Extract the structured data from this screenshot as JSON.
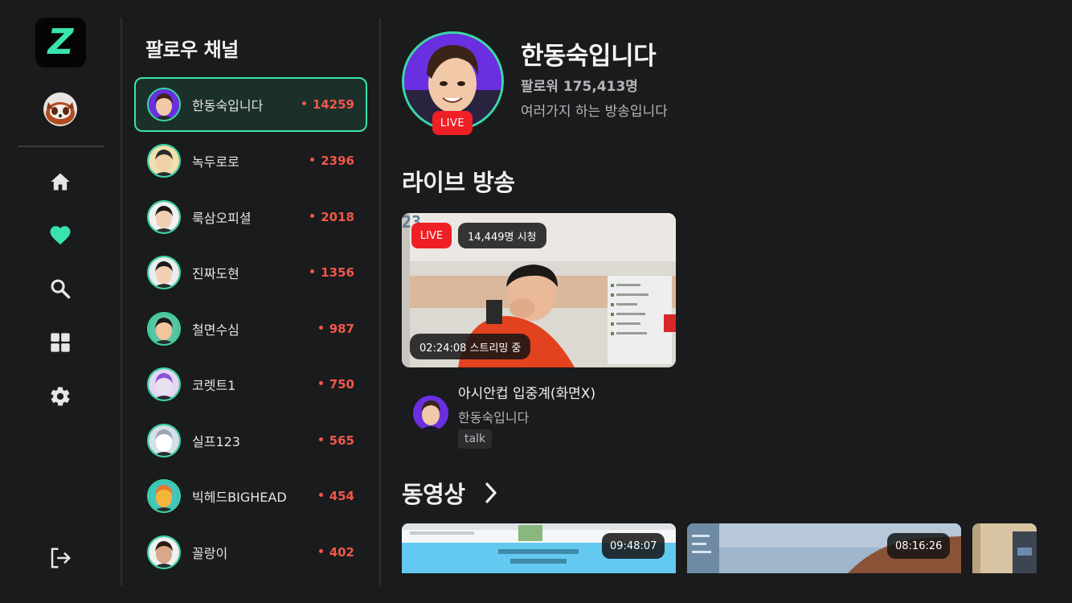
{
  "app": {
    "logo_letter": "Z",
    "accent_color": "#38e3ae",
    "live_color": "#ef1f26",
    "count_color": "#f0574c"
  },
  "nav": {
    "items": [
      {
        "name": "home-icon",
        "active": false
      },
      {
        "name": "heart-icon",
        "active": true
      },
      {
        "name": "search-icon",
        "active": false
      },
      {
        "name": "grid-icon",
        "active": false
      },
      {
        "name": "gear-icon",
        "active": false
      }
    ],
    "logout_icon": "logout-icon"
  },
  "follow": {
    "title": "팔로우 채널",
    "items": [
      {
        "name": "한동숙입니다",
        "count": "14259"
      },
      {
        "name": "녹두로로",
        "count": "2396"
      },
      {
        "name": "룩삼오피셜",
        "count": "2018"
      },
      {
        "name": "진짜도현",
        "count": "1356"
      },
      {
        "name": "철면수심",
        "count": "987"
      },
      {
        "name": "코렛트1",
        "count": "750"
      },
      {
        "name": "실프123",
        "count": "565"
      },
      {
        "name": "빅헤드BIGHEAD",
        "count": "454"
      },
      {
        "name": "꼴랑이",
        "count": "402"
      }
    ]
  },
  "channel": {
    "name": "한동숙입니다",
    "followers": "팔로워 175,413명",
    "description": "여러가지 하는 방송입니다",
    "live_badge": "LIVE"
  },
  "live_section": {
    "title": "라이브 방송",
    "stream": {
      "live_badge": "LIVE",
      "viewers": "14,449명 시청",
      "elapsed": "02:24:08 스트리밍 중",
      "title": "아시안컵 입중계(화면X)",
      "channel": "한동숙입니다",
      "tag": "talk"
    }
  },
  "video_section": {
    "title": "동영상",
    "videos": [
      {
        "duration": "09:48:07"
      },
      {
        "duration": "08:16:26"
      }
    ]
  }
}
